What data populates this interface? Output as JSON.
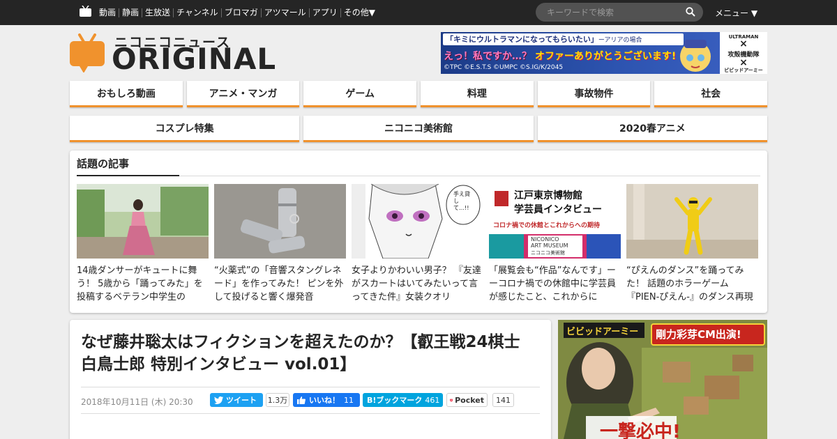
{
  "topbar": {
    "nav": [
      "動画",
      "静画",
      "生放送",
      "チャンネル",
      "ブロマガ",
      "アツマール",
      "アプリ",
      "その他▼"
    ],
    "search_placeholder": "キーワードで検索",
    "menu_label": "メニュー ▼"
  },
  "logo": {
    "sub": "ニコニコニュース",
    "main": "ORIGINAL"
  },
  "banner": {
    "headline": "「キミにウルトラマンになってもらいたい」",
    "headline_small": "ーアリアの場合",
    "sub_a": "えっ！私ですか…？",
    "sub_b": "オファーありがとうございます!",
    "copyright": "©TPC ©E.S.T.S ©UMPC ©S.IG/K/2045",
    "logo_1": "ULTRAMAN",
    "logo_2": "攻殻機動隊",
    "logo_3": "ビビッドアーミー"
  },
  "categories_row1": [
    "おもしろ動画",
    "アニメ・マンガ",
    "ゲーム",
    "料理",
    "事故物件",
    "社会"
  ],
  "categories_row2": [
    "コスプレ特集",
    "ニコニコ美術館",
    "2020春アニメ"
  ],
  "trending": {
    "title": "話題の記事",
    "cards": [
      {
        "title": "14歳ダンサーがキュートに舞う！ 5歳から「踊ってみた」を投稿するベテラン中学生の"
      },
      {
        "title": "“火薬式”の「音響スタングレネード」を作ってみた！ ピンを外して投げると響く爆発音"
      },
      {
        "title": "女子よりかわいい男子？ 『友達がスカートはいてみたいって言ってきた件』女装クオリ"
      },
      {
        "title": "「展覧会も“作品”なんです」ーーコロナ禍での休館中に学芸員が感じたこと、これからに"
      },
      {
        "title": "“ぴえんのダンス”を踊ってみた！ 話題のホラーゲーム『PIEN-ぴえん-』のダンス再現に"
      }
    ],
    "thumb4": {
      "line1": "江戸東京博物館",
      "line2": "学芸員インタビュー",
      "line3": "コロナ禍での休館とこれからへの期待",
      "line4": "NICONICO",
      "line5": "ART MUSEUM",
      "line6": "ニコニコ美術館"
    },
    "thumb3_bubble": "手え貸して…!!"
  },
  "article": {
    "title": "なぜ藤井聡太はフィクションを超えたのか？【叡王戦24棋士 白鳥士郎 特別インタビュー vol.01】",
    "date": "2018年10月11日 (木) 20:30",
    "tweet_label": "ツイート",
    "tweet_count": "1.3万",
    "like_label": "いいね！",
    "like_count": "11",
    "hatena_label": "B!ブックマーク",
    "hatena_count": "461",
    "pocket_label": "Pocket",
    "pocket_count": "141"
  },
  "sidead": {
    "brand": "ビビッドアーミー",
    "headline": "剛力彩芽CM出演!",
    "bottom": "一撃必中!"
  },
  "colors": {
    "accent": "#f0922d",
    "topbar": "#252525",
    "twitter": "#1da1f2",
    "facebook": "#1877f2",
    "hatena": "#00a4de",
    "pocket": "#ef4056"
  }
}
